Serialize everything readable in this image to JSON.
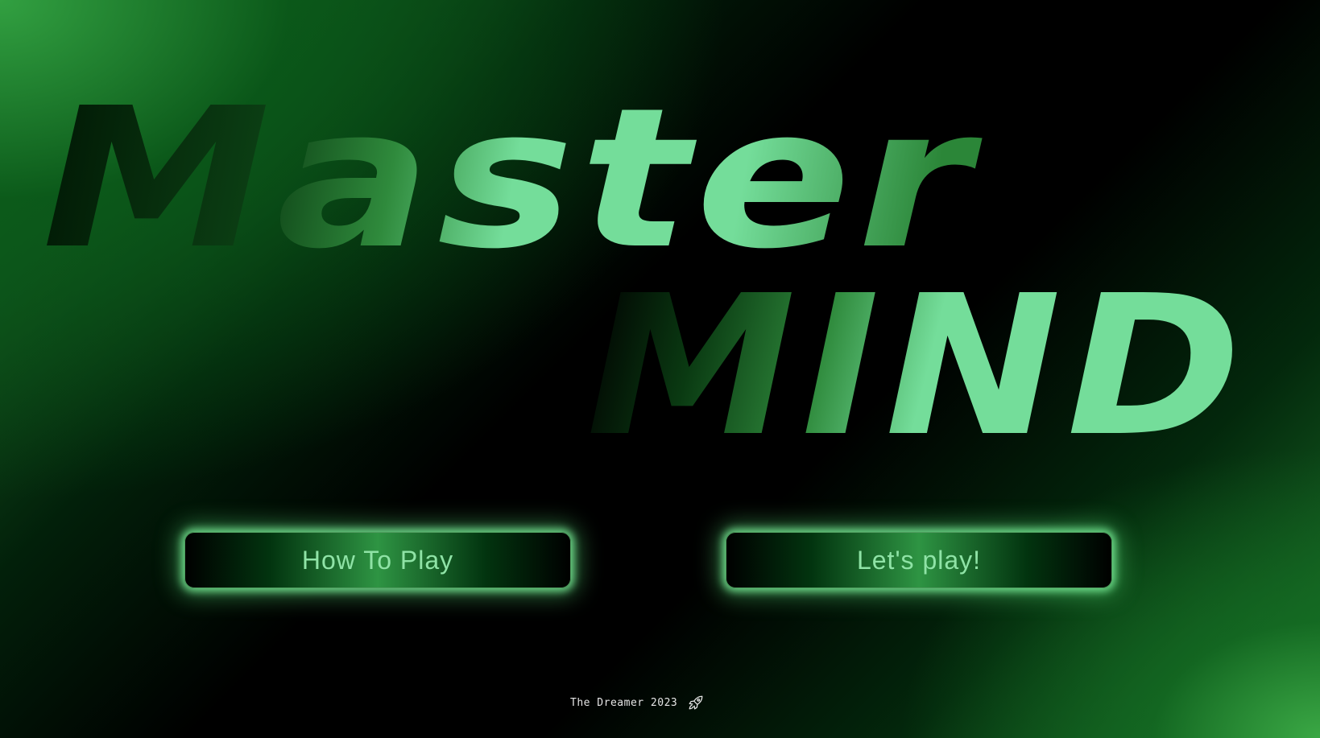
{
  "title": {
    "line1": "Master",
    "line2": "MIND"
  },
  "buttons": {
    "how_to_play": "How To Play",
    "lets_play": "Let's play!"
  },
  "footer": {
    "credit": "The Dreamer 2023",
    "icon": "rocket-icon"
  },
  "colors": {
    "title_light": "#74dd9a",
    "title_mid": "#2f8a3c",
    "title_dark": "#021c06",
    "button_text": "#8fe3a6",
    "button_glow": "#78eb96"
  }
}
